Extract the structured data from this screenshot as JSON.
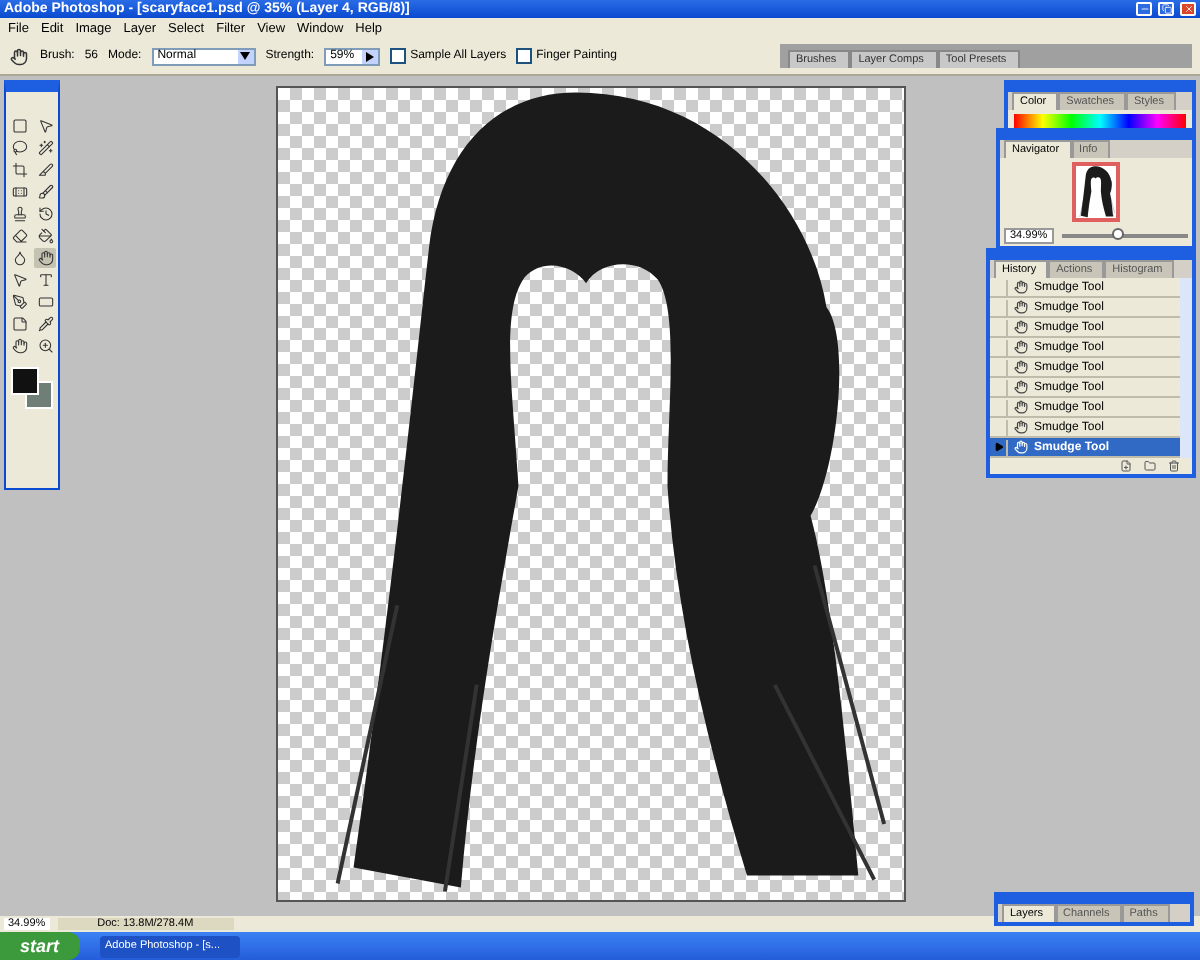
{
  "window": {
    "title": "Adobe Photoshop - [scaryface1.psd @ 35% (Layer 4, RGB/8)]"
  },
  "menu": [
    "File",
    "Edit",
    "Image",
    "Layer",
    "Select",
    "Filter",
    "View",
    "Window",
    "Help"
  ],
  "options_bar": {
    "brush_label": "Brush:",
    "brush_size": "56",
    "mode_label": "Mode:",
    "mode_value": "Normal",
    "strength_label": "Strength:",
    "strength_value": "59%",
    "checkboxes": [
      {
        "label": "Sample All Layers",
        "checked": false
      },
      {
        "label": "Finger Painting",
        "checked": false
      }
    ],
    "palette_well_tabs": [
      "Brushes",
      "Layer Comps",
      "Tool Presets"
    ]
  },
  "color_panel": {
    "tabs": [
      {
        "label": "Color",
        "selected": true
      },
      {
        "label": "Swatches",
        "selected": false
      },
      {
        "label": "Styles",
        "selected": false
      }
    ]
  },
  "navigator_panel": {
    "tabs": [
      {
        "label": "Navigator",
        "selected": true
      },
      {
        "label": "Info",
        "selected": false
      }
    ],
    "zoom": "34.99%",
    "slider": {
      "level": 0.45
    }
  },
  "history_panel": {
    "tabs": [
      {
        "label": "History",
        "selected": true
      },
      {
        "label": "Actions",
        "selected": false
      },
      {
        "label": "Histogram",
        "selected": false
      }
    ],
    "items": [
      {
        "label": "Smudge Tool",
        "selected": false
      },
      {
        "label": "Smudge Tool",
        "selected": false
      },
      {
        "label": "Smudge Tool",
        "selected": false
      },
      {
        "label": "Smudge Tool",
        "selected": false
      },
      {
        "label": "Smudge Tool",
        "selected": false
      },
      {
        "label": "Smudge Tool",
        "selected": false
      },
      {
        "label": "Smudge Tool",
        "selected": false
      },
      {
        "label": "Smudge Tool",
        "selected": false
      },
      {
        "label": "Smudge Tool",
        "selected": true
      }
    ]
  },
  "layers_panel": {
    "tabs": [
      {
        "label": "Layers",
        "selected": true
      },
      {
        "label": "Channels",
        "selected": false
      },
      {
        "label": "Paths",
        "selected": false
      }
    ]
  },
  "status_bar": {
    "zoom": "34.99%",
    "doc_info": "Doc: 13.8M/278.4M"
  },
  "taskbar": {
    "start": "start",
    "tasks": [
      "Adobe Photoshop - [s..."
    ]
  }
}
